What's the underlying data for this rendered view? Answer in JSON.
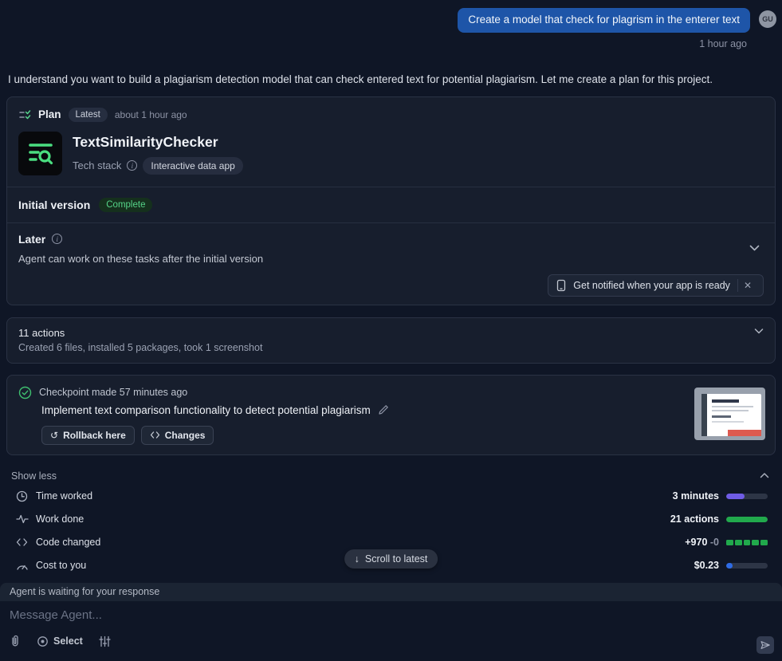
{
  "user_message": {
    "text": "Create a model that check for plagrism in the enterer text",
    "avatar_initials": "GU",
    "timestamp": "1 hour ago"
  },
  "agent_intro": "I understand you want to build a plagiarism detection model that can check entered text for potential plagiarism. Let me create a plan for this project.",
  "plan_card": {
    "label": "Plan",
    "version_badge": "Latest",
    "timestamp": "about 1 hour ago",
    "app_name": "TextSimilarityChecker",
    "app_icon": "text-search-icon",
    "tech_stack_label": "Tech stack",
    "tech_stack_value": "Interactive data app",
    "initial_version_label": "Initial version",
    "initial_version_status": "Complete",
    "later_label": "Later",
    "later_description": "Agent can work on these tasks after the initial version",
    "notification_text": "Get notified when your app is ready"
  },
  "actions_summary": {
    "title": "11 actions",
    "subtitle": "Created 6 files, installed 5 packages, took 1 screenshot"
  },
  "checkpoint": {
    "made_text": "Checkpoint made 57 minutes ago",
    "title": "Implement text comparison functionality to detect potential plagiarism",
    "rollback_label": "Rollback here",
    "changes_label": "Changes"
  },
  "stats": {
    "show_less_label": "Show less",
    "rows": [
      {
        "icon": "clock-icon",
        "label": "Time worked",
        "value": "3 minutes",
        "bar": {
          "type": "solid",
          "fill_pct": 45,
          "color": "#6f5ce6"
        }
      },
      {
        "icon": "activity-icon",
        "label": "Work done",
        "value": "21 actions",
        "bar": {
          "type": "solid",
          "fill_pct": 100,
          "color": "#21a94c"
        }
      },
      {
        "icon": "code-icon",
        "label": "Code changed",
        "value": "+970",
        "value_dim": "-0",
        "bar": {
          "type": "segmented",
          "segments": 5,
          "color": "#21a94c"
        }
      },
      {
        "icon": "gauge-icon",
        "label": "Cost to you",
        "value": "$0.23",
        "bar": {
          "type": "solid",
          "fill_pct": 16,
          "color": "#2e6be5"
        }
      }
    ]
  },
  "scroll_button_label": "Scroll to latest",
  "footer": {
    "status_text": "Agent is waiting for your response",
    "input_placeholder": "Message Agent...",
    "select_label": "Select"
  },
  "colors": {
    "user_bubble": "#1e55a8",
    "success_green": "#55d388",
    "accent_purple": "#6f5ce6",
    "accent_blue": "#2e6be5",
    "bar_green": "#21a94c"
  }
}
